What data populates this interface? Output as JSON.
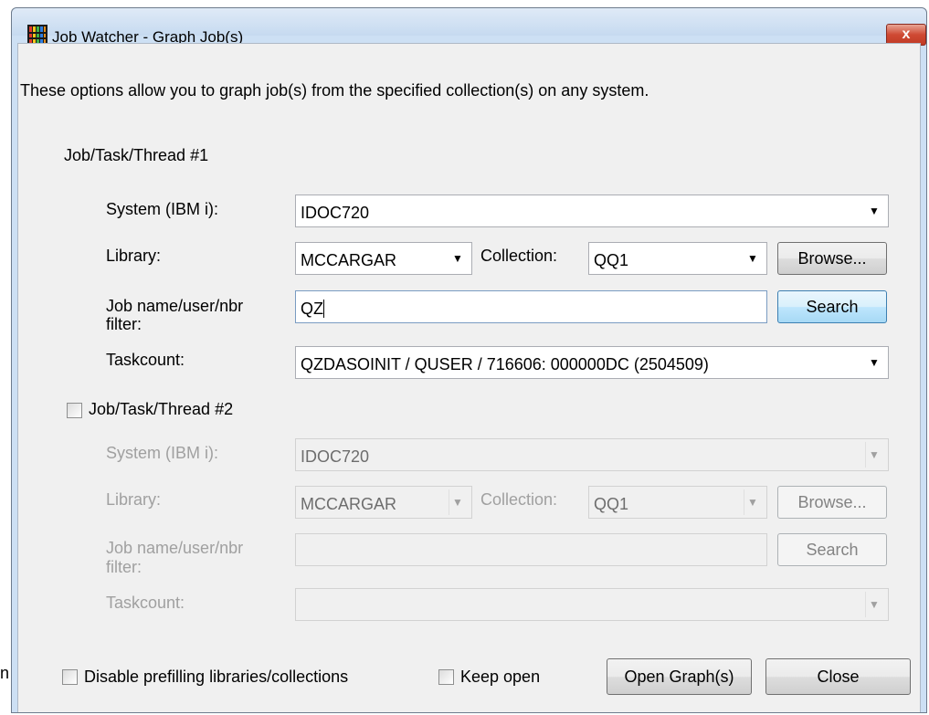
{
  "background_fragment": "n",
  "window": {
    "title": "Job Watcher - Graph Job(s)",
    "close_glyph": "x",
    "app_icon": "job-watcher-app-icon"
  },
  "intro_text": "These options allow you to graph job(s) from the specified collection(s) on any system.",
  "group1": {
    "heading": "Job/Task/Thread #1",
    "system_label": "System (IBM i):",
    "system_value": "IDOC720",
    "library_label": "Library:",
    "library_value": "MCCARGAR",
    "collection_label": "Collection:",
    "collection_value": "QQ1",
    "browse_label": "Browse...",
    "job_filter_label_line1": "Job name/user/nbr",
    "job_filter_label_line2": "filter:",
    "job_filter_value": "QZ",
    "search_label": "Search",
    "taskcount_label": "Taskcount:",
    "taskcount_value": "QZDASOINIT / QUSER / 716606: 000000DC (2504509)"
  },
  "group2": {
    "heading": "Job/Task/Thread #2",
    "checked": false,
    "system_label": "System (IBM i):",
    "system_value": "IDOC720",
    "library_label": "Library:",
    "library_value": "MCCARGAR",
    "collection_label": "Collection:",
    "collection_value": "QQ1",
    "browse_label": "Browse...",
    "job_filter_label_line1": "Job name/user/nbr",
    "job_filter_label_line2": "filter:",
    "job_filter_value": "",
    "search_label": "Search",
    "taskcount_label": "Taskcount:",
    "taskcount_value": ""
  },
  "footer": {
    "disable_prefill_label": "Disable prefilling libraries/collections",
    "disable_prefill_checked": false,
    "keep_open_label": "Keep open",
    "keep_open_checked": false,
    "open_graph_label": "Open Graph(s)",
    "close_label": "Close"
  },
  "colors": {
    "frame": "#cde0f4",
    "client": "#f0f0f0",
    "close_button": "#c75050",
    "hot_button_border": "#3c7fb1",
    "disabled_text": "#a0a0a0"
  }
}
